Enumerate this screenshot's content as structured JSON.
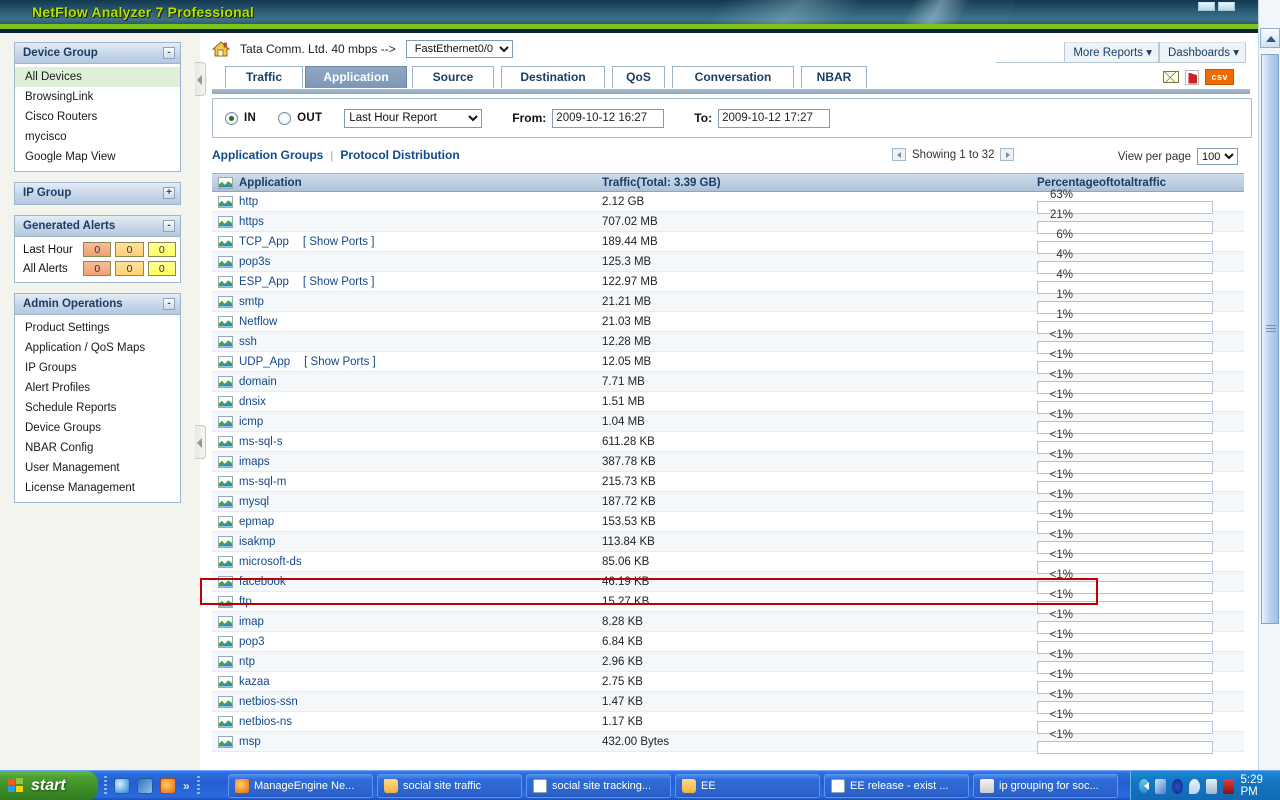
{
  "window": {
    "app_title": "NetFlow Analyzer 7 Professional"
  },
  "device_bar": {
    "home_icon": "home-icon",
    "device_label": "Tata Comm. Ltd. 40 mbps -->",
    "interface_selected": "FastEthernet0/0"
  },
  "header_buttons": {
    "more_reports": "More Reports",
    "dashboards": "Dashboards"
  },
  "tabs": [
    {
      "label": "Traffic",
      "active": false
    },
    {
      "label": "Application",
      "active": true
    },
    {
      "label": "Source",
      "active": false
    },
    {
      "label": "Destination",
      "active": false
    },
    {
      "label": "QoS",
      "active": false
    },
    {
      "label": "Conversation",
      "active": false
    },
    {
      "label": "NBAR",
      "active": false
    }
  ],
  "export_icons": [
    {
      "name": "mail-icon"
    },
    {
      "name": "pdf-icon"
    },
    {
      "name": "csv-icon",
      "label": "csv"
    }
  ],
  "filters": {
    "direction_in": "IN",
    "direction_out": "OUT",
    "direction_selected": "IN",
    "report_period": "Last Hour Report",
    "from_label": "From:",
    "from_value": "2009-10-12 16:27",
    "to_label": "To:",
    "to_value": "2009-10-12 17:27"
  },
  "sublinks": {
    "application_groups": "Application Groups",
    "separator": "|",
    "protocol_distribution": "Protocol Distribution"
  },
  "paging": {
    "showing": "Showing 1 to 32",
    "view_per_page_label": "View per page",
    "view_per_page_value": "100"
  },
  "table": {
    "headers": {
      "application": "Application",
      "traffic": "Traffic(Total: 3.39 GB)",
      "percentage": "Percentageoftotaltraffic"
    },
    "rows": [
      {
        "app": "http",
        "ports": "",
        "traffic": "2.12 GB",
        "pct": "63%",
        "bar": 63,
        "color": "magenta",
        "highlight": false
      },
      {
        "app": "https",
        "ports": "",
        "traffic": "707.02 MB",
        "pct": "21%",
        "bar": 21,
        "color": "green",
        "highlight": false
      },
      {
        "app": "TCP_App",
        "ports": "[ Show Ports ]",
        "traffic": "189.44 MB",
        "pct": "6%",
        "bar": 6,
        "color": "green",
        "highlight": false
      },
      {
        "app": "pop3s",
        "ports": "",
        "traffic": "125.3 MB",
        "pct": "4%",
        "bar": 4,
        "color": "green",
        "highlight": false
      },
      {
        "app": "ESP_App",
        "ports": "[ Show Ports ]",
        "traffic": "122.97 MB",
        "pct": "4%",
        "bar": 4,
        "color": "green",
        "highlight": false
      },
      {
        "app": "smtp",
        "ports": "",
        "traffic": "21.21 MB",
        "pct": "1%",
        "bar": 1,
        "color": "green",
        "highlight": false
      },
      {
        "app": "Netflow",
        "ports": "",
        "traffic": "21.03 MB",
        "pct": "1%",
        "bar": 1,
        "color": "green",
        "highlight": false
      },
      {
        "app": "ssh",
        "ports": "",
        "traffic": "12.28 MB",
        "pct": "<1%",
        "bar": 0.6,
        "color": "green",
        "highlight": false
      },
      {
        "app": "UDP_App",
        "ports": "[ Show Ports ]",
        "traffic": "12.05 MB",
        "pct": "<1%",
        "bar": 0.6,
        "color": "green",
        "highlight": false
      },
      {
        "app": "domain",
        "ports": "",
        "traffic": "7.71 MB",
        "pct": "<1%",
        "bar": 0.6,
        "color": "green",
        "highlight": false
      },
      {
        "app": "dnsix",
        "ports": "",
        "traffic": "1.51 MB",
        "pct": "<1%",
        "bar": 0.6,
        "color": "green",
        "highlight": false
      },
      {
        "app": "icmp",
        "ports": "",
        "traffic": "1.04 MB",
        "pct": "<1%",
        "bar": 0.6,
        "color": "green",
        "highlight": false
      },
      {
        "app": "ms-sql-s",
        "ports": "",
        "traffic": "611.28 KB",
        "pct": "<1%",
        "bar": 0.6,
        "color": "green",
        "highlight": false
      },
      {
        "app": "imaps",
        "ports": "",
        "traffic": "387.78 KB",
        "pct": "<1%",
        "bar": 0.6,
        "color": "green",
        "highlight": false
      },
      {
        "app": "ms-sql-m",
        "ports": "",
        "traffic": "215.73 KB",
        "pct": "<1%",
        "bar": 0.6,
        "color": "green",
        "highlight": false
      },
      {
        "app": "mysql",
        "ports": "",
        "traffic": "187.72 KB",
        "pct": "<1%",
        "bar": 0.6,
        "color": "green",
        "highlight": false
      },
      {
        "app": "epmap",
        "ports": "",
        "traffic": "153.53 KB",
        "pct": "<1%",
        "bar": 0.6,
        "color": "green",
        "highlight": false
      },
      {
        "app": "isakmp",
        "ports": "",
        "traffic": "113.84 KB",
        "pct": "<1%",
        "bar": 0.6,
        "color": "green",
        "highlight": false
      },
      {
        "app": "microsoft-ds",
        "ports": "",
        "traffic": "85.06 KB",
        "pct": "<1%",
        "bar": 0.6,
        "color": "green",
        "highlight": false
      },
      {
        "app": "facebook",
        "ports": "",
        "traffic": "46.19 KB",
        "pct": "<1%",
        "bar": 0,
        "color": "green",
        "highlight": true
      },
      {
        "app": "ftp",
        "ports": "",
        "traffic": "15.27 KB",
        "pct": "<1%",
        "bar": 0.4,
        "color": "green",
        "highlight": false
      },
      {
        "app": "imap",
        "ports": "",
        "traffic": "8.28 KB",
        "pct": "<1%",
        "bar": 0.4,
        "color": "green",
        "highlight": false
      },
      {
        "app": "pop3",
        "ports": "",
        "traffic": "6.84 KB",
        "pct": "<1%",
        "bar": 0.4,
        "color": "green",
        "highlight": false
      },
      {
        "app": "ntp",
        "ports": "",
        "traffic": "2.96 KB",
        "pct": "<1%",
        "bar": 0.4,
        "color": "green",
        "highlight": false
      },
      {
        "app": "kazaa",
        "ports": "",
        "traffic": "2.75 KB",
        "pct": "<1%",
        "bar": 0.4,
        "color": "green",
        "highlight": false
      },
      {
        "app": "netbios-ssn",
        "ports": "",
        "traffic": "1.47 KB",
        "pct": "<1%",
        "bar": 0.4,
        "color": "green",
        "highlight": false
      },
      {
        "app": "netbios-ns",
        "ports": "",
        "traffic": "1.17 KB",
        "pct": "<1%",
        "bar": 0.4,
        "color": "green",
        "highlight": false
      },
      {
        "app": "msp",
        "ports": "",
        "traffic": "432.00 Bytes",
        "pct": "<1%",
        "bar": 0.4,
        "color": "green",
        "highlight": false
      }
    ]
  },
  "sidebar": {
    "device_group": {
      "title": "Device Group",
      "toggle": "-",
      "items": [
        {
          "label": "All Devices",
          "selected": true
        },
        {
          "label": "BrowsingLink",
          "selected": false
        },
        {
          "label": "Cisco Routers",
          "selected": false
        },
        {
          "label": "mycisco",
          "selected": false
        },
        {
          "label": "Google Map View",
          "selected": false
        }
      ]
    },
    "ip_group": {
      "title": "IP Group",
      "toggle": "+"
    },
    "generated_alerts": {
      "title": "Generated Alerts",
      "toggle": "-",
      "rows": [
        {
          "label": "Last Hour",
          "values": [
            "0",
            "0",
            "0"
          ]
        },
        {
          "label": "All Alerts",
          "values": [
            "0",
            "0",
            "0"
          ]
        }
      ]
    },
    "admin_operations": {
      "title": "Admin Operations",
      "toggle": "-",
      "items": [
        {
          "label": "Product Settings"
        },
        {
          "label": "Application / QoS Maps"
        },
        {
          "label": "IP Groups"
        },
        {
          "label": "Alert Profiles"
        },
        {
          "label": "Schedule Reports"
        },
        {
          "label": "Device Groups"
        },
        {
          "label": "NBAR Config"
        },
        {
          "label": "User Management"
        },
        {
          "label": "License Management"
        }
      ]
    }
  },
  "taskbar": {
    "start_label": "start",
    "quick_launch": [
      "ie-icon",
      "outlook-icon",
      "firefox-icon"
    ],
    "quick_chevron": "»",
    "tasks": [
      {
        "label": "ManageEngine Ne...",
        "icon": "firefox-icon"
      },
      {
        "label": "social site traffic",
        "icon": "folder-icon"
      },
      {
        "label": "social site tracking...",
        "icon": "document-icon"
      },
      {
        "label": "EE",
        "icon": "folder-icon"
      },
      {
        "label": "EE release - exist ...",
        "icon": "document-icon"
      },
      {
        "label": "ip grouping for soc...",
        "icon": "paint-icon"
      }
    ],
    "tray_icons": [
      "show-hidden-icon",
      "network-icon",
      "volume-icon",
      "messenger-icon",
      "monitor-icon",
      "antivirus-icon"
    ],
    "clock": "5:29 PM"
  },
  "colors": {
    "accent_green": "#7fc41c",
    "bar_magenta": "#ff00ee",
    "bar_green": "#22dd22",
    "highlight_red": "#c00000",
    "title_text": "#b4e000"
  }
}
